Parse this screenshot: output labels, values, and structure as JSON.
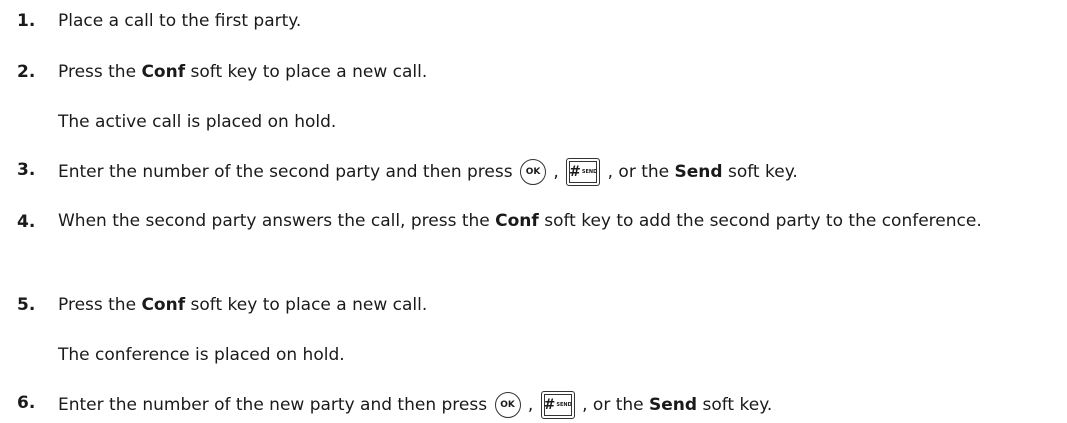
{
  "steps": [
    {
      "number": "1.",
      "text": "Place a call to the first party."
    },
    {
      "number": "2.",
      "pre": "Press the ",
      "bold": "Conf",
      "post": " soft key to place a new call.",
      "note": "The active call is placed on hold."
    },
    {
      "number": "3.",
      "pre": "Enter the number of the second party and then press ",
      "mid": " , ",
      "after_keys": " , or the ",
      "bold": "Send",
      "post": " soft key."
    },
    {
      "number": "4.",
      "pre": "When the second party answers the call, press the ",
      "bold": "Conf",
      "post": " soft key to add the second party to the conference."
    },
    {
      "number": "5.",
      "pre": "Press the ",
      "bold": "Conf",
      "post": " soft key to place a new call.",
      "note": "The conference is placed on hold."
    },
    {
      "number": "6.",
      "pre": "Enter the number of the new party and then press ",
      "mid": " , ",
      "after_keys": " , or the ",
      "bold": "Send",
      "post": " soft key."
    }
  ],
  "keys": {
    "ok": "OK",
    "send_hash": "#",
    "send_sub": "SEND"
  }
}
